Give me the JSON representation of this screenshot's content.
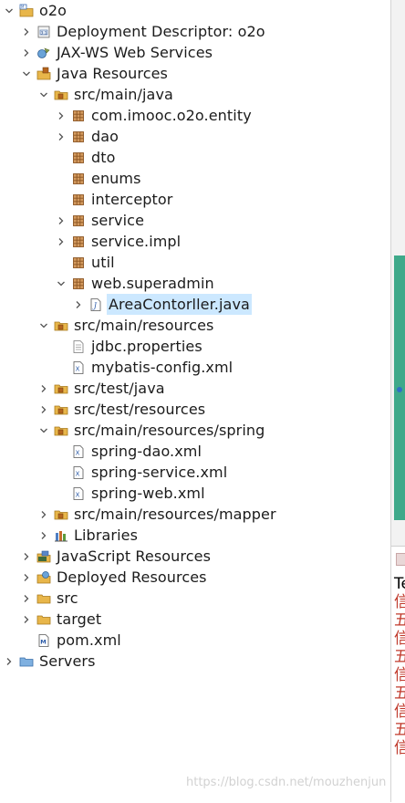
{
  "tree": [
    {
      "label": "o2o",
      "icon": "web-project-icon",
      "chevron": "down"
    },
    {
      "label": "Deployment Descriptor: o2o",
      "icon": "deployment-descriptor-icon",
      "chevron": "right"
    },
    {
      "label": "JAX-WS Web Services",
      "icon": "web-services-icon",
      "chevron": "right"
    },
    {
      "label": "Java Resources",
      "icon": "java-resources-icon",
      "chevron": "down"
    },
    {
      "label": "src/main/java",
      "icon": "source-folder-icon",
      "chevron": "down"
    },
    {
      "label": "com.imooc.o2o.entity",
      "icon": "package-icon",
      "chevron": "right"
    },
    {
      "label": "dao",
      "icon": "package-icon",
      "chevron": "right"
    },
    {
      "label": "dto",
      "icon": "package-icon",
      "chevron": "none"
    },
    {
      "label": "enums",
      "icon": "package-icon",
      "chevron": "none"
    },
    {
      "label": "interceptor",
      "icon": "package-icon",
      "chevron": "none"
    },
    {
      "label": "service",
      "icon": "package-icon",
      "chevron": "right"
    },
    {
      "label": "service.impl",
      "icon": "package-icon",
      "chevron": "right"
    },
    {
      "label": "util",
      "icon": "package-icon",
      "chevron": "none"
    },
    {
      "label": "web.superadmin",
      "icon": "package-icon",
      "chevron": "down"
    },
    {
      "label": "AreaContorller.java",
      "icon": "java-file-icon",
      "chevron": "right",
      "selected": true
    },
    {
      "label": "src/main/resources",
      "icon": "source-folder-icon",
      "chevron": "down"
    },
    {
      "label": "jdbc.properties",
      "icon": "properties-file-icon",
      "chevron": "none"
    },
    {
      "label": "mybatis-config.xml",
      "icon": "xml-file-icon",
      "chevron": "none"
    },
    {
      "label": "src/test/java",
      "icon": "source-folder-icon",
      "chevron": "right"
    },
    {
      "label": "src/test/resources",
      "icon": "source-folder-icon",
      "chevron": "right"
    },
    {
      "label": "src/main/resources/spring",
      "icon": "source-folder-icon",
      "chevron": "down"
    },
    {
      "label": "spring-dao.xml",
      "icon": "xml-file-icon",
      "chevron": "none"
    },
    {
      "label": "spring-service.xml",
      "icon": "xml-file-icon",
      "chevron": "none"
    },
    {
      "label": "spring-web.xml",
      "icon": "xml-file-icon",
      "chevron": "none"
    },
    {
      "label": "src/main/resources/mapper",
      "icon": "source-folder-icon",
      "chevron": "right"
    },
    {
      "label": "Libraries",
      "icon": "libraries-icon",
      "chevron": "right"
    },
    {
      "label": "JavaScript Resources",
      "icon": "javascript-resources-icon",
      "chevron": "right"
    },
    {
      "label": "Deployed Resources",
      "icon": "deployed-resources-icon",
      "chevron": "right"
    },
    {
      "label": "src",
      "icon": "folder-icon",
      "chevron": "right"
    },
    {
      "label": "target",
      "icon": "folder-icon",
      "chevron": "right"
    },
    {
      "label": "pom.xml",
      "icon": "maven-pom-icon",
      "chevron": "none"
    },
    {
      "label": "Servers",
      "icon": "servers-folder-icon",
      "chevron": "right"
    }
  ],
  "console": {
    "lines": [
      "Te",
      "信",
      "五",
      "信",
      "五",
      "信",
      "五",
      "信",
      "五",
      "信"
    ]
  },
  "watermark": "https://blog.csdn.net/mouzhenjun",
  "colors": {
    "selection": "#cce8ff",
    "package": "#b5651d",
    "folder": "#e8b64a",
    "scroll_thumb": "#3fa98a",
    "console_text": "#c0392b"
  }
}
